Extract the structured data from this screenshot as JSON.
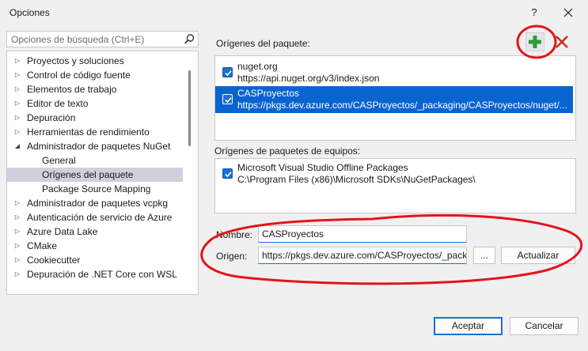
{
  "window": {
    "title": "Opciones",
    "help_glyph": "?",
    "close_icon": "close-icon"
  },
  "search": {
    "placeholder": "Opciones de búsqueda (Ctrl+E)",
    "icon": "search-icon"
  },
  "tree": {
    "items": [
      {
        "label": "Proyectos y soluciones",
        "expandable": true,
        "expanded": false,
        "level": 0
      },
      {
        "label": "Control de código fuente",
        "expandable": true,
        "expanded": false,
        "level": 0
      },
      {
        "label": "Elementos de trabajo",
        "expandable": true,
        "expanded": false,
        "level": 0
      },
      {
        "label": "Editor de texto",
        "expandable": true,
        "expanded": false,
        "level": 0
      },
      {
        "label": "Depuración",
        "expandable": true,
        "expanded": false,
        "level": 0
      },
      {
        "label": "Herramientas de rendimiento",
        "expandable": true,
        "expanded": false,
        "level": 0
      },
      {
        "label": "Administrador de paquetes NuGet",
        "expandable": true,
        "expanded": true,
        "level": 0
      },
      {
        "label": "General",
        "expandable": false,
        "level": 1
      },
      {
        "label": "Orígenes del paquete",
        "expandable": false,
        "level": 1,
        "selected": true
      },
      {
        "label": "Package Source Mapping",
        "expandable": false,
        "level": 1
      },
      {
        "label": "Administrador de paquetes vcpkg",
        "expandable": true,
        "expanded": false,
        "level": 0
      },
      {
        "label": "Autenticación de servicio de Azure",
        "expandable": true,
        "expanded": false,
        "level": 0
      },
      {
        "label": "Azure Data Lake",
        "expandable": true,
        "expanded": false,
        "level": 0
      },
      {
        "label": "CMake",
        "expandable": true,
        "expanded": false,
        "level": 0
      },
      {
        "label": "Cookiecutter",
        "expandable": true,
        "expanded": false,
        "level": 0
      },
      {
        "label": "Depuración de .NET Core con WSL",
        "expandable": true,
        "expanded": false,
        "level": 0
      }
    ]
  },
  "sources": {
    "label": "Orígenes del paquete:",
    "add_icon": "plus-icon",
    "remove_icon": "remove-x-icon",
    "items": [
      {
        "name": "nuget.org",
        "url": "https://api.nuget.org/v3/index.json",
        "checked": true,
        "selected": false
      },
      {
        "name": "CASProyectos",
        "url": "https://pkgs.dev.azure.com/CASProyectos/_packaging/CASProyectos/nuget/...",
        "checked": true,
        "selected": true
      }
    ]
  },
  "machine_sources": {
    "label": "Orígenes de paquetes de equipos:",
    "items": [
      {
        "name": "Microsoft Visual Studio Offline Packages",
        "url": "C:\\Program Files (x86)\\Microsoft SDKs\\NuGetPackages\\",
        "checked": true
      }
    ]
  },
  "form": {
    "name_label": "Nombre:",
    "name_value": "CASProyectos",
    "source_label": "Origen:",
    "source_value": "https://pkgs.dev.azure.com/CASProyectos/_pack",
    "browse_label": "...",
    "update_label": "Actualizar"
  },
  "footer": {
    "ok_label": "Aceptar",
    "cancel_label": "Cancelar"
  },
  "colors": {
    "accent": "#1f6fd1",
    "selection": "#0a64d0",
    "tree_selection": "#d0d0dd",
    "add_green": "#2e9b3a",
    "remove_red": "#c42b1c",
    "annotation_red": "#e4141c"
  }
}
